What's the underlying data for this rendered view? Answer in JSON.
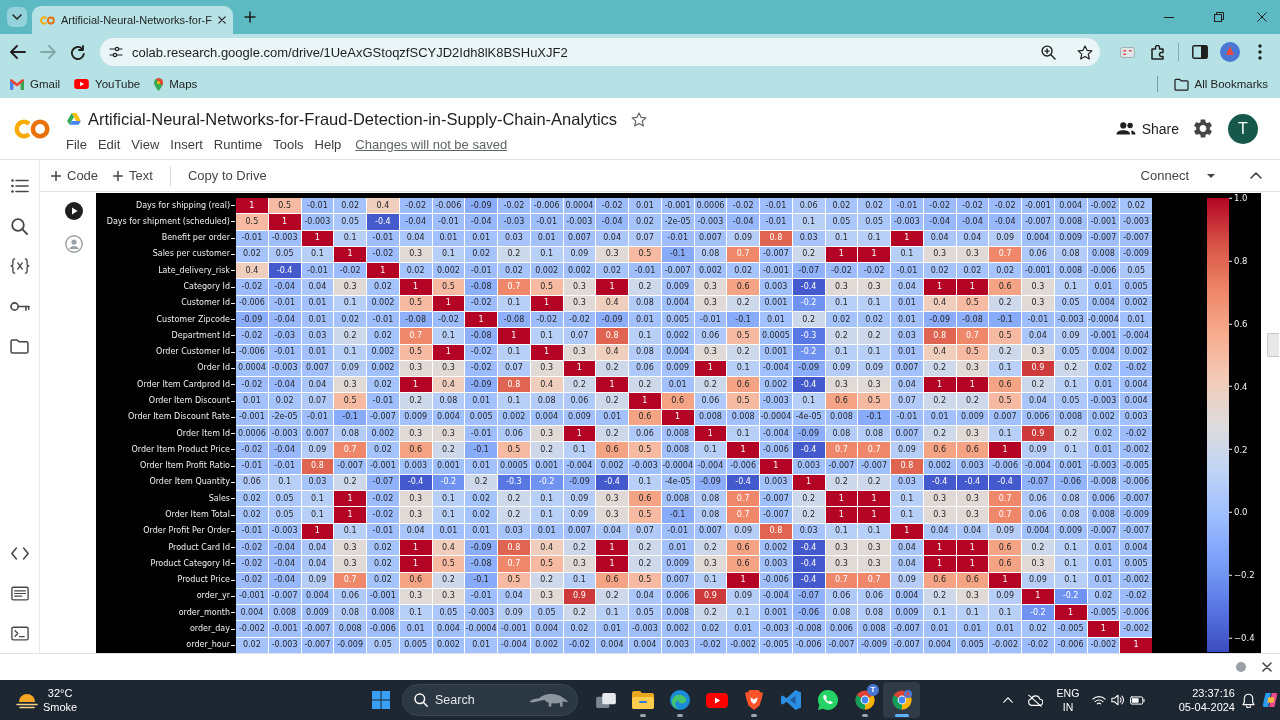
{
  "browser": {
    "tabs": [
      {
        "title": "Artificial-Neural-Networks-for-F",
        "selected": true
      }
    ],
    "nav_buttons": [
      {
        "disabled": false
      },
      {
        "disabled": true
      },
      {
        "disabled": false
      }
    ],
    "address": "colab.research.google.com/drive/1UeAxGStoqzfSCYJD2Idh8lK8BSHuXJF2",
    "bookmarks": [
      {
        "label": "Gmail"
      },
      {
        "label": "YouTube"
      },
      {
        "label": "Maps"
      }
    ],
    "all_bookmarks": "All Bookmarks"
  },
  "notebook": {
    "title": "Artificial-Neural-Networks-for-Fraud-Detection-in-Supply-Chain-Analytics",
    "menu": [
      "File",
      "Edit",
      "View",
      "Insert",
      "Runtime",
      "Tools",
      "Help"
    ],
    "save_notice": "Changes will not be saved",
    "share": "Share",
    "avatar": "T",
    "toolbar": {
      "add_code": "Code",
      "add_text": "Text",
      "copy_to_drive": "Copy to Drive",
      "connect": "Connect"
    }
  },
  "correlation_heatmap": {
    "rows": [
      {
        "label": "Days for shipping (real)",
        "cells": [
          "1",
          "0.5",
          "-0.01",
          "0.02",
          "0.4",
          "-0.02",
          "-0.006",
          "-0.09",
          "-0.02",
          "-0.006",
          "0.0004",
          "-0.02",
          "0.01",
          "-0.001",
          "0.0006",
          "-0.02",
          "-0.01",
          "0.06",
          "0.02",
          "0.02",
          "-0.01",
          "-0.02",
          "-0.02",
          "-0.02",
          "-0.001",
          "0.004",
          "-0.002",
          "0.02"
        ]
      },
      {
        "label": "Days for shipment (scheduled)",
        "cells": [
          "0.5",
          "1",
          "-0.003",
          "0.05",
          "-0.4",
          "-0.04",
          "-0.01",
          "-0.04",
          "-0.03",
          "-0.01",
          "-0.003",
          "-0.04",
          "0.02",
          "-2e-05",
          "-0.003",
          "-0.04",
          "-0.01",
          "0.1",
          "0.05",
          "0.05",
          "-0.003",
          "-0.04",
          "-0.04",
          "-0.04",
          "-0.007",
          "0.008",
          "-0.001",
          "-0.003"
        ]
      },
      {
        "label": "Benefit per order",
        "cells": [
          "-0.01",
          "-0.003",
          "1",
          "0.1",
          "-0.01",
          "0.04",
          "0.01",
          "0.01",
          "0.03",
          "0.01",
          "0.007",
          "0.04",
          "0.07",
          "-0.01",
          "0.007",
          "0.09",
          "0.8",
          "0.03",
          "0.1",
          "0.1",
          "1",
          "0.04",
          "0.04",
          "0.09",
          "0.004",
          "0.009",
          "-0.007",
          "-0.007"
        ]
      },
      {
        "label": "Sales per customer",
        "cells": [
          "0.02",
          "0.05",
          "0.1",
          "1",
          "-0.02",
          "0.3",
          "0.1",
          "0.02",
          "0.2",
          "0.1",
          "0.09",
          "0.3",
          "0.5",
          "-0.1",
          "0.08",
          "0.7",
          "-0.007",
          "0.2",
          "1",
          "1",
          "0.1",
          "0.3",
          "0.3",
          "0.7",
          "0.06",
          "0.08",
          "0.008",
          "-0.009"
        ]
      },
      {
        "label": "Late_delivery_risk",
        "cells": [
          "0.4",
          "-0.4",
          "-0.01",
          "-0.02",
          "1",
          "0.02",
          "0.002",
          "-0.01",
          "0.02",
          "0.002",
          "0.002",
          "0.02",
          "-0.01",
          "-0.007",
          "0.002",
          "0.02",
          "-0.001",
          "-0.07",
          "-0.02",
          "-0.02",
          "-0.01",
          "0.02",
          "0.02",
          "0.02",
          "-0.001",
          "0.008",
          "-0.006",
          "0.05"
        ]
      },
      {
        "label": "Category Id",
        "cells": [
          "-0.02",
          "-0.04",
          "0.04",
          "0.3",
          "0.02",
          "1",
          "0.5",
          "-0.08",
          "0.7",
          "0.5",
          "0.3",
          "1",
          "0.2",
          "0.009",
          "0.3",
          "0.6",
          "0.003",
          "-0.4",
          "0.3",
          "0.3",
          "0.04",
          "1",
          "1",
          "0.6",
          "0.3",
          "0.1",
          "0.01",
          "0.005"
        ]
      },
      {
        "label": "Customer Id",
        "cells": [
          "-0.006",
          "-0.01",
          "0.01",
          "0.1",
          "0.002",
          "0.5",
          "1",
          "-0.02",
          "0.1",
          "1",
          "0.3",
          "0.4",
          "0.08",
          "0.004",
          "0.3",
          "0.2",
          "0.001",
          "-0.2",
          "0.1",
          "0.1",
          "0.01",
          "0.4",
          "0.5",
          "0.2",
          "0.3",
          "0.05",
          "0.004",
          "0.002"
        ]
      },
      {
        "label": "Customer Zipcode",
        "cells": [
          "-0.09",
          "-0.04",
          "0.01",
          "0.02",
          "-0.01",
          "-0.08",
          "-0.02",
          "1",
          "-0.08",
          "-0.02",
          "-0.02",
          "-0.09",
          "0.01",
          "0.005",
          "-0.01",
          "-0.1",
          "0.01",
          "0.2",
          "0.02",
          "0.02",
          "0.01",
          "-0.09",
          "-0.08",
          "-0.1",
          "-0.01",
          "-0.003",
          "-0.0004",
          "0.01"
        ]
      },
      {
        "label": "Department Id",
        "cells": [
          "-0.02",
          "-0.03",
          "0.03",
          "0.2",
          "0.02",
          "0.7",
          "0.1",
          "-0.08",
          "1",
          "0.1",
          "0.07",
          "0.8",
          "0.1",
          "0.002",
          "0.06",
          "0.5",
          "0.0005",
          "-0.3",
          "0.2",
          "0.2",
          "0.03",
          "0.8",
          "0.7",
          "0.5",
          "0.04",
          "0.09",
          "-0.001",
          "-0.004"
        ]
      },
      {
        "label": "Order Customer Id",
        "cells": [
          "-0.006",
          "-0.01",
          "0.01",
          "0.1",
          "0.002",
          "0.5",
          "1",
          "-0.02",
          "0.1",
          "1",
          "0.3",
          "0.4",
          "0.08",
          "0.004",
          "0.3",
          "0.2",
          "0.001",
          "-0.2",
          "0.1",
          "0.1",
          "0.01",
          "0.4",
          "0.5",
          "0.2",
          "0.3",
          "0.05",
          "0.004",
          "0.002"
        ]
      },
      {
        "label": "Order Id",
        "cells": [
          "0.0004",
          "-0.003",
          "0.007",
          "0.09",
          "0.002",
          "0.3",
          "0.3",
          "-0.02",
          "0.07",
          "0.3",
          "1",
          "0.2",
          "0.06",
          "0.009",
          "1",
          "0.1",
          "-0.004",
          "-0.09",
          "0.09",
          "0.09",
          "0.007",
          "0.2",
          "0.3",
          "0.1",
          "0.9",
          "0.2",
          "0.02",
          "-0.02"
        ]
      },
      {
        "label": "Order Item Cardprod Id",
        "cells": [
          "-0.02",
          "-0.04",
          "0.04",
          "0.3",
          "0.02",
          "1",
          "0.4",
          "-0.09",
          "0.8",
          "0.4",
          "0.2",
          "1",
          "0.2",
          "0.01",
          "0.2",
          "0.6",
          "0.002",
          "-0.4",
          "0.3",
          "0.3",
          "0.04",
          "1",
          "1",
          "0.6",
          "0.2",
          "0.1",
          "0.01",
          "0.004"
        ]
      },
      {
        "label": "Order Item Discount",
        "cells": [
          "0.01",
          "0.02",
          "0.07",
          "0.5",
          "-0.01",
          "0.2",
          "0.08",
          "0.01",
          "0.1",
          "0.08",
          "0.06",
          "0.2",
          "1",
          "0.6",
          "0.06",
          "0.5",
          "-0.003",
          "0.1",
          "0.6",
          "0.5",
          "0.07",
          "0.2",
          "0.2",
          "0.5",
          "0.04",
          "0.05",
          "-0.003",
          "0.004"
        ]
      },
      {
        "label": "Order Item Discount Rate",
        "cells": [
          "-0.001",
          "-2e-05",
          "-0.01",
          "-0.1",
          "-0.007",
          "0.009",
          "0.004",
          "0.005",
          "0.002",
          "0.004",
          "0.009",
          "0.01",
          "0.6",
          "1",
          "0.008",
          "0.008",
          "-0.0004",
          "-4e-05",
          "0.008",
          "-0.1",
          "-0.01",
          "0.01",
          "0.009",
          "0.007",
          "0.006",
          "0.008",
          "0.002",
          "0.003"
        ]
      },
      {
        "label": "Order Item Id",
        "cells": [
          "0.0006",
          "-0.003",
          "0.007",
          "0.08",
          "0.002",
          "0.3",
          "0.3",
          "-0.01",
          "0.06",
          "0.3",
          "1",
          "0.2",
          "0.06",
          "0.008",
          "1",
          "0.1",
          "-0.004",
          "-0.09",
          "0.08",
          "0.08",
          "0.007",
          "0.2",
          "0.3",
          "0.1",
          "0.9",
          "0.2",
          "0.02",
          "-0.02"
        ]
      },
      {
        "label": "Order Item Product Price",
        "cells": [
          "-0.02",
          "-0.04",
          "0.09",
          "0.7",
          "0.02",
          "0.6",
          "0.2",
          "-0.1",
          "0.5",
          "0.2",
          "0.1",
          "0.6",
          "0.5",
          "0.008",
          "0.1",
          "1",
          "-0.006",
          "-0.4",
          "0.7",
          "0.7",
          "0.09",
          "0.6",
          "0.6",
          "1",
          "0.09",
          "0.1",
          "0.01",
          "-0.002"
        ]
      },
      {
        "label": "Order Item Profit Ratio",
        "cells": [
          "-0.01",
          "-0.01",
          "0.8",
          "-0.007",
          "-0.001",
          "0.003",
          "0.001",
          "0.01",
          "0.0005",
          "0.001",
          "-0.004",
          "0.002",
          "-0.003",
          "-0.0004",
          "-0.004",
          "-0.006",
          "1",
          "0.003",
          "-0.007",
          "-0.007",
          "0.8",
          "0.002",
          "0.003",
          "-0.006",
          "-0.004",
          "0.001",
          "-0.003",
          "-0.005"
        ]
      },
      {
        "label": "Order Item Quantity",
        "cells": [
          "0.06",
          "0.1",
          "0.03",
          "0.2",
          "-0.07",
          "-0.4",
          "-0.2",
          "0.2",
          "-0.3",
          "-0.2",
          "-0.09",
          "-0.4",
          "0.1",
          "-4e-05",
          "-0.09",
          "-0.4",
          "0.003",
          "1",
          "0.2",
          "0.2",
          "0.03",
          "-0.4",
          "-0.4",
          "-0.4",
          "-0.07",
          "-0.06",
          "-0.008",
          "-0.006"
        ]
      },
      {
        "label": "Sales",
        "cells": [
          "0.02",
          "0.05",
          "0.1",
          "1",
          "-0.02",
          "0.3",
          "0.1",
          "0.02",
          "0.2",
          "0.1",
          "0.09",
          "0.3",
          "0.6",
          "0.008",
          "0.08",
          "0.7",
          "-0.007",
          "0.2",
          "1",
          "1",
          "0.1",
          "0.3",
          "0.3",
          "0.7",
          "0.06",
          "0.08",
          "0.006",
          "-0.007"
        ]
      },
      {
        "label": "Order Item Total",
        "cells": [
          "0.02",
          "0.05",
          "0.1",
          "1",
          "-0.02",
          "0.3",
          "0.1",
          "0.02",
          "0.2",
          "0.1",
          "0.09",
          "0.3",
          "0.5",
          "-0.1",
          "0.08",
          "0.7",
          "-0.007",
          "0.2",
          "1",
          "1",
          "0.1",
          "0.3",
          "0.3",
          "0.7",
          "0.06",
          "0.08",
          "0.008",
          "-0.009"
        ]
      },
      {
        "label": "Order Profit Per Order",
        "cells": [
          "-0.01",
          "-0.003",
          "1",
          "0.1",
          "-0.01",
          "0.04",
          "0.01",
          "0.01",
          "0.03",
          "0.01",
          "0.007",
          "0.04",
          "0.07",
          "-0.01",
          "0.007",
          "0.09",
          "0.8",
          "0.03",
          "0.1",
          "0.1",
          "1",
          "0.04",
          "0.04",
          "0.09",
          "0.004",
          "0.009",
          "-0.007",
          "-0.007"
        ]
      },
      {
        "label": "Product Card Id",
        "cells": [
          "-0.02",
          "-0.04",
          "0.04",
          "0.3",
          "0.02",
          "1",
          "0.4",
          "-0.09",
          "0.8",
          "0.4",
          "0.2",
          "1",
          "0.2",
          "0.01",
          "0.2",
          "0.6",
          "0.002",
          "-0.4",
          "0.3",
          "0.3",
          "0.04",
          "1",
          "1",
          "0.6",
          "0.2",
          "0.1",
          "0.01",
          "0.004"
        ]
      },
      {
        "label": "Product Category Id",
        "cells": [
          "-0.02",
          "-0.04",
          "0.04",
          "0.3",
          "0.02",
          "1",
          "0.5",
          "-0.08",
          "0.7",
          "0.5",
          "0.3",
          "1",
          "0.2",
          "0.009",
          "0.3",
          "0.6",
          "0.003",
          "-0.4",
          "0.3",
          "0.3",
          "0.04",
          "1",
          "1",
          "0.6",
          "0.3",
          "0.1",
          "0.01",
          "0.005"
        ]
      },
      {
        "label": "Product Price",
        "cells": [
          "-0.02",
          "-0.04",
          "0.09",
          "0.7",
          "0.02",
          "0.6",
          "0.2",
          "-0.1",
          "0.5",
          "0.2",
          "0.1",
          "0.6",
          "0.5",
          "0.007",
          "0.1",
          "1",
          "-0.006",
          "-0.4",
          "0.7",
          "0.7",
          "0.09",
          "0.6",
          "0.6",
          "1",
          "0.09",
          "0.1",
          "0.01",
          "-0.002"
        ]
      },
      {
        "label": "order_yr",
        "cells": [
          "-0.001",
          "-0.007",
          "0.004",
          "0.06",
          "-0.001",
          "0.3",
          "0.3",
          "-0.01",
          "0.04",
          "0.3",
          "0.9",
          "0.2",
          "0.04",
          "0.006",
          "0.9",
          "0.09",
          "-0.004",
          "-0.07",
          "0.06",
          "0.06",
          "0.004",
          "0.2",
          "0.3",
          "0.09",
          "1",
          "-0.2",
          "0.02",
          "-0.02"
        ]
      },
      {
        "label": "order_month",
        "cells": [
          "0.004",
          "0.008",
          "0.009",
          "0.08",
          "0.008",
          "0.1",
          "0.05",
          "-0.003",
          "0.09",
          "0.05",
          "0.2",
          "0.1",
          "0.05",
          "0.008",
          "0.2",
          "0.1",
          "0.001",
          "-0.06",
          "0.08",
          "0.08",
          "0.009",
          "0.1",
          "0.1",
          "0.1",
          "-0.2",
          "1",
          "-0.005",
          "-0.006"
        ]
      },
      {
        "label": "order_day",
        "cells": [
          "-0.002",
          "-0.001",
          "-0.007",
          "0.008",
          "-0.006",
          "0.01",
          "0.004",
          "-0.0004",
          "-0.001",
          "0.004",
          "0.02",
          "0.01",
          "-0.003",
          "0.002",
          "0.02",
          "0.01",
          "-0.003",
          "-0.008",
          "0.006",
          "0.008",
          "-0.007",
          "0.01",
          "0.01",
          "0.01",
          "0.02",
          "-0.005",
          "1",
          "-0.002"
        ]
      },
      {
        "label": "order_hour",
        "cells": [
          "0.02",
          "-0.003",
          "-0.007",
          "-0.009",
          "0.05",
          "0.005",
          "0.002",
          "0.01",
          "-0.004",
          "0.002",
          "-0.02",
          "0.004",
          "0.004",
          "0.003",
          "-0.02",
          "-0.002",
          "-0.005",
          "-0.006",
          "-0.007",
          "-0.009",
          "-0.007",
          "0.004",
          "0.005",
          "-0.002",
          "-0.02",
          "-0.006",
          "-0.002",
          "1"
        ]
      }
    ],
    "colorbar_ticks": [
      "1.0",
      "0.8",
      "0.6",
      "0.4",
      "0.2",
      "0.0",
      "−0.2",
      "−0.4"
    ]
  },
  "taskbar": {
    "weather": {
      "temperature": "32°C",
      "condition": "Smoke"
    },
    "search_label": "Search",
    "apps": [
      {
        "running": false,
        "selected": false
      },
      {
        "running": true,
        "selected": false
      },
      {
        "running": true,
        "selected": false
      },
      {
        "running": false,
        "selected": false
      },
      {
        "running": true,
        "selected": false
      },
      {
        "running": false,
        "selected": false
      },
      {
        "running": false,
        "selected": false
      },
      {
        "running": true,
        "selected": false,
        "badge": "T"
      },
      {
        "running": true,
        "selected": true
      }
    ],
    "language": {
      "input": "ENG",
      "region": "IN"
    },
    "time": "23:37:16",
    "date": "05-04-2024"
  }
}
